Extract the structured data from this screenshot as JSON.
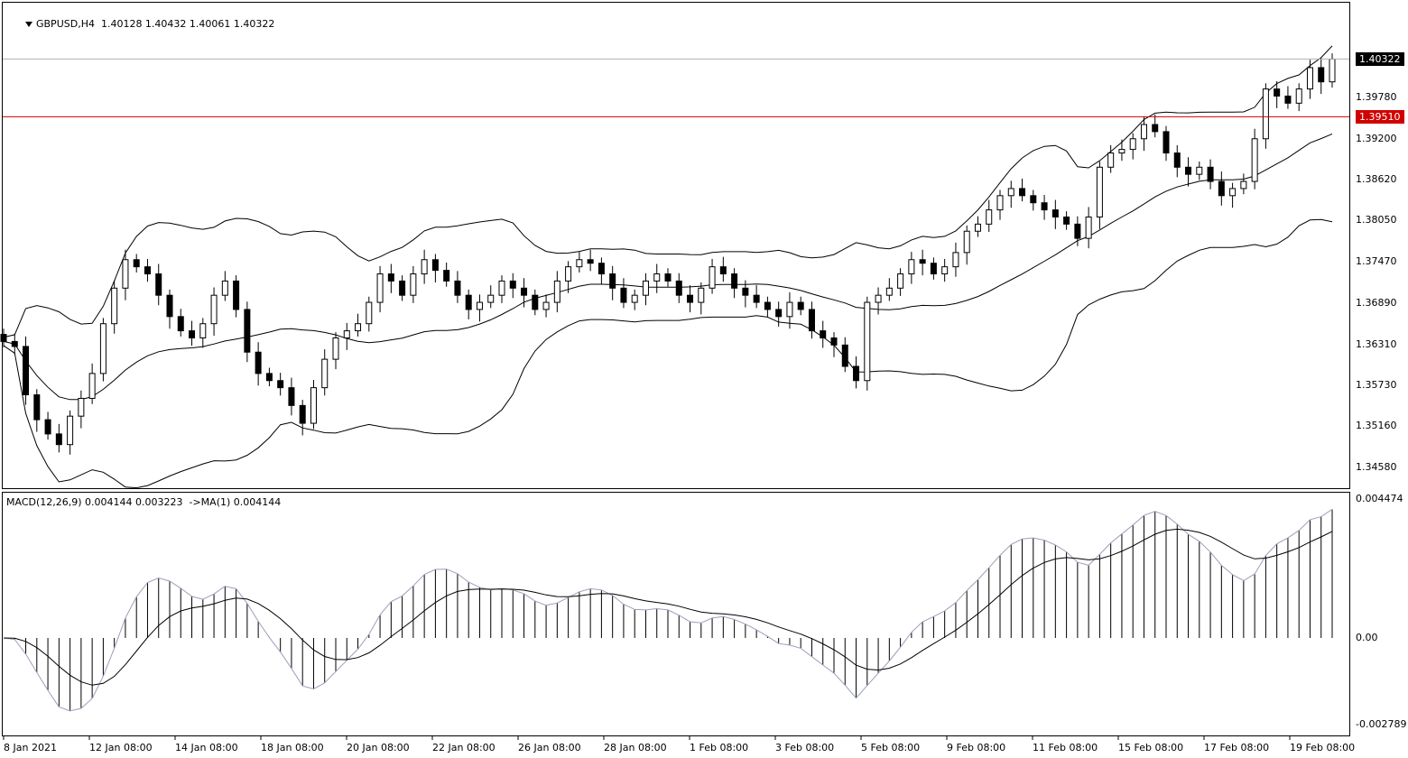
{
  "main_chart": {
    "title": "GBPUSD,H4  1.40128 1.40432 1.40061 1.40322",
    "price_labels": [
      "1.40322",
      "1.39780",
      "1.39510",
      "1.39200",
      "1.38620",
      "1.38050",
      "1.37470",
      "1.36890",
      "1.36310",
      "1.35730",
      "1.35160",
      "1.34580"
    ],
    "current_price": "1.40322",
    "level_price": "1.39510",
    "level_color": "#d00000"
  },
  "macd_chart": {
    "title": "MACD(12,26,9) 0.004144 0.003223  ->MA(1) 0.004144",
    "value_labels": [
      "0.004474",
      "0.00",
      "-0.002789"
    ]
  },
  "x_axis": {
    "labels": [
      "8 Jan 2021",
      "12 Jan 08:00",
      "14 Jan 08:00",
      "18 Jan 08:00",
      "20 Jan 08:00",
      "22 Jan 08:00",
      "26 Jan 08:00",
      "28 Jan 08:00",
      "1 Feb 08:00",
      "3 Feb 08:00",
      "5 Feb 08:00",
      "9 Feb 08:00",
      "11 Feb 08:00",
      "15 Feb 08:00",
      "17 Feb 08:00",
      "19 Feb 08:00"
    ]
  },
  "chart_data": [
    {
      "type": "candlestick",
      "symbol": "GBPUSD",
      "timeframe": "H4",
      "ylim": [
        1.343,
        1.411
      ],
      "indicators": [
        "Bollinger Bands"
      ],
      "level_line": 1.3951,
      "close_series": [
        1.3635,
        1.3628,
        1.356,
        1.3525,
        1.3505,
        1.349,
        1.353,
        1.3555,
        1.359,
        1.366,
        1.371,
        1.375,
        1.374,
        1.373,
        1.37,
        1.367,
        1.365,
        1.364,
        1.366,
        1.37,
        1.372,
        1.368,
        1.362,
        1.359,
        1.358,
        1.357,
        1.3545,
        1.352,
        1.357,
        1.361,
        1.364,
        1.365,
        1.366,
        1.369,
        1.373,
        1.372,
        1.37,
        1.373,
        1.375,
        1.3735,
        1.372,
        1.37,
        1.368,
        1.369,
        1.37,
        1.372,
        1.371,
        1.37,
        1.368,
        1.369,
        1.372,
        1.374,
        1.375,
        1.3745,
        1.373,
        1.371,
        1.369,
        1.37,
        1.372,
        1.373,
        1.372,
        1.37,
        1.369,
        1.371,
        1.374,
        1.373,
        1.371,
        1.37,
        1.369,
        1.368,
        1.367,
        1.369,
        1.368,
        1.365,
        1.364,
        1.363,
        1.36,
        1.358,
        1.369,
        1.37,
        1.371,
        1.373,
        1.375,
        1.3745,
        1.373,
        1.374,
        1.376,
        1.379,
        1.38,
        1.382,
        1.384,
        1.385,
        1.384,
        1.383,
        1.382,
        1.381,
        1.38,
        1.378,
        1.381,
        1.388,
        1.39,
        1.3905,
        1.392,
        1.394,
        1.393,
        1.39,
        1.388,
        1.387,
        1.388,
        1.386,
        1.384,
        1.385,
        1.386,
        1.392,
        1.399,
        1.398,
        1.397,
        1.399,
        1.402,
        1.4,
        1.4032
      ]
    },
    {
      "type": "bar",
      "name": "MACD(12,26,9)",
      "ylim": [
        -0.002789,
        0.004474
      ],
      "histogram_last": 0.004144,
      "signal_last": 0.003223
    }
  ]
}
